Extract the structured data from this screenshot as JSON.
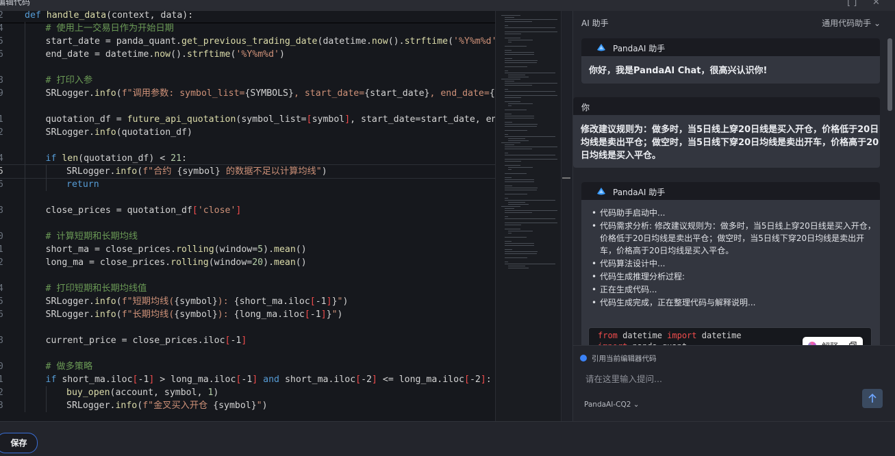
{
  "window": {
    "title": "编辑代码"
  },
  "editor": {
    "lines": [
      {
        "n": "2",
        "indent": 0,
        "tokens": [
          [
            "kw",
            "def "
          ],
          [
            "fn",
            "handle_data"
          ],
          [
            "id",
            "(context, data):"
          ]
        ]
      },
      {
        "n": "4",
        "indent": 1,
        "tokens": [
          [
            "cm",
            "# 使用上一交易日作为开始日期"
          ]
        ]
      },
      {
        "n": "5",
        "indent": 1,
        "tokens": [
          [
            "id",
            "start_date = panda_quant."
          ],
          [
            "fn",
            "get_previous_trading_date"
          ],
          [
            "id",
            "(datetime."
          ],
          [
            "fn",
            "now"
          ],
          [
            "id",
            "()."
          ],
          [
            "fn",
            "strftime"
          ],
          [
            "id",
            "("
          ],
          [
            "str",
            "'%Y%m%d'"
          ],
          [
            "id",
            "))"
          ]
        ]
      },
      {
        "n": "6",
        "indent": 1,
        "tokens": [
          [
            "id",
            "end_date = datetime."
          ],
          [
            "fn",
            "now"
          ],
          [
            "id",
            "()."
          ],
          [
            "fn",
            "strftime"
          ],
          [
            "id",
            "("
          ],
          [
            "str",
            "'%Y%m%d'"
          ],
          [
            "id",
            ")"
          ]
        ]
      },
      {
        "n": "",
        "indent": 1,
        "tokens": []
      },
      {
        "n": "8",
        "indent": 1,
        "tokens": [
          [
            "cm",
            "# 打印入参"
          ]
        ]
      },
      {
        "n": "9",
        "indent": 1,
        "tokens": [
          [
            "id",
            "SRLogger."
          ],
          [
            "fn",
            "info"
          ],
          [
            "id",
            "("
          ],
          [
            "str",
            "f\"调用参数: symbol_list="
          ],
          [
            "id",
            "{SYMBOLS}"
          ],
          [
            "str",
            ", start_date="
          ],
          [
            "id",
            "{start_date}"
          ],
          [
            "str",
            ", end_date="
          ],
          [
            "id",
            "{en"
          ]
        ]
      },
      {
        "n": "",
        "indent": 1,
        "tokens": []
      },
      {
        "n": "1",
        "indent": 1,
        "tokens": [
          [
            "id",
            "quotation_df = "
          ],
          [
            "fn",
            "future_api_quotation"
          ],
          [
            "id",
            "(symbol_list="
          ],
          [
            "red",
            "["
          ],
          [
            "id",
            "symbol"
          ],
          [
            "red",
            "]"
          ],
          [
            "id",
            ", start_date=start_date, end_d"
          ]
        ]
      },
      {
        "n": "2",
        "indent": 1,
        "tokens": [
          [
            "id",
            "SRLogger."
          ],
          [
            "fn",
            "info"
          ],
          [
            "id",
            "(quotation_df)"
          ]
        ]
      },
      {
        "n": "",
        "indent": 1,
        "tokens": []
      },
      {
        "n": "4",
        "indent": 1,
        "tokens": [
          [
            "kw",
            "if "
          ],
          [
            "fn",
            "len"
          ],
          [
            "id",
            "(quotation_df) < "
          ],
          [
            "num",
            "21"
          ],
          [
            "id",
            ":"
          ]
        ]
      },
      {
        "n": "5",
        "indent": 2,
        "active": true,
        "tokens": [
          [
            "id",
            "SRLogger."
          ],
          [
            "fn",
            "info"
          ],
          [
            "id",
            "("
          ],
          [
            "str",
            "f\"合约 "
          ],
          [
            "id",
            "{symbol}"
          ],
          [
            "str",
            " 的数据不足以计算均线\""
          ],
          [
            "id",
            ")"
          ]
        ]
      },
      {
        "n": "6",
        "indent": 2,
        "tokens": [
          [
            "kw",
            "return"
          ]
        ]
      },
      {
        "n": "",
        "indent": 1,
        "tokens": []
      },
      {
        "n": "8",
        "indent": 1,
        "tokens": [
          [
            "id",
            "close_prices = quotation_df"
          ],
          [
            "red",
            "["
          ],
          [
            "str",
            "'close'"
          ],
          [
            "red",
            "]"
          ]
        ]
      },
      {
        "n": "",
        "indent": 1,
        "tokens": []
      },
      {
        "n": "0",
        "indent": 1,
        "tokens": [
          [
            "cm",
            "# 计算短期和长期均线"
          ]
        ]
      },
      {
        "n": "1",
        "indent": 1,
        "tokens": [
          [
            "id",
            "short_ma = close_prices."
          ],
          [
            "fn",
            "rolling"
          ],
          [
            "id",
            "(window="
          ],
          [
            "num",
            "5"
          ],
          [
            "id",
            ")."
          ],
          [
            "fn",
            "mean"
          ],
          [
            "id",
            "()"
          ]
        ]
      },
      {
        "n": "2",
        "indent": 1,
        "tokens": [
          [
            "id",
            "long_ma = close_prices."
          ],
          [
            "fn",
            "rolling"
          ],
          [
            "id",
            "(window="
          ],
          [
            "num",
            "20"
          ],
          [
            "id",
            ")."
          ],
          [
            "fn",
            "mean"
          ],
          [
            "id",
            "()"
          ]
        ]
      },
      {
        "n": "",
        "indent": 1,
        "tokens": []
      },
      {
        "n": "4",
        "indent": 1,
        "tokens": [
          [
            "cm",
            "# 打印短期和长期均线值"
          ]
        ]
      },
      {
        "n": "5",
        "indent": 1,
        "tokens": [
          [
            "id",
            "SRLogger."
          ],
          [
            "fn",
            "info"
          ],
          [
            "id",
            "("
          ],
          [
            "str",
            "f\"短期均线("
          ],
          [
            "id",
            "{symbol}"
          ],
          [
            "str",
            "): "
          ],
          [
            "id",
            "{short_ma.iloc"
          ],
          [
            "red",
            "["
          ],
          [
            "id",
            "-1"
          ],
          [
            "red",
            "]"
          ],
          [
            "id",
            "}"
          ],
          [
            "str",
            "\""
          ],
          [
            "id",
            ")"
          ]
        ]
      },
      {
        "n": "6",
        "indent": 1,
        "tokens": [
          [
            "id",
            "SRLogger."
          ],
          [
            "fn",
            "info"
          ],
          [
            "id",
            "("
          ],
          [
            "str",
            "f\"长期均线("
          ],
          [
            "id",
            "{symbol}"
          ],
          [
            "str",
            "): "
          ],
          [
            "id",
            "{long_ma.iloc"
          ],
          [
            "red",
            "["
          ],
          [
            "id",
            "-1"
          ],
          [
            "red",
            "]"
          ],
          [
            "id",
            "}"
          ],
          [
            "str",
            "\""
          ],
          [
            "id",
            ")"
          ]
        ]
      },
      {
        "n": "",
        "indent": 1,
        "tokens": []
      },
      {
        "n": "8",
        "indent": 1,
        "tokens": [
          [
            "id",
            "current_price = close_prices.iloc"
          ],
          [
            "red",
            "["
          ],
          [
            "id",
            "-1"
          ],
          [
            "red",
            "]"
          ]
        ]
      },
      {
        "n": "",
        "indent": 1,
        "tokens": []
      },
      {
        "n": "0",
        "indent": 1,
        "tokens": [
          [
            "cm",
            "# 做多策略"
          ]
        ]
      },
      {
        "n": "1",
        "indent": 1,
        "tokens": [
          [
            "kw",
            "if "
          ],
          [
            "id",
            "short_ma.iloc"
          ],
          [
            "red",
            "["
          ],
          [
            "id",
            "-1"
          ],
          [
            "red",
            "]"
          ],
          [
            "id",
            " > long_ma.iloc"
          ],
          [
            "red",
            "["
          ],
          [
            "id",
            "-1"
          ],
          [
            "red",
            "]"
          ],
          [
            "kw",
            " and "
          ],
          [
            "id",
            "short_ma.iloc"
          ],
          [
            "red",
            "["
          ],
          [
            "id",
            "-2"
          ],
          [
            "red",
            "]"
          ],
          [
            "id",
            " <= long_ma.iloc"
          ],
          [
            "red",
            "["
          ],
          [
            "id",
            "-2"
          ],
          [
            "red",
            "]"
          ],
          [
            "id",
            ":"
          ]
        ]
      },
      {
        "n": "2",
        "indent": 2,
        "tokens": [
          [
            "fn",
            "buy_open"
          ],
          [
            "id",
            "(account, symbol, "
          ],
          [
            "num",
            "1"
          ],
          [
            "id",
            ")"
          ]
        ]
      },
      {
        "n": "3",
        "indent": 2,
        "tokens": [
          [
            "id",
            "SRLogger."
          ],
          [
            "fn",
            "info"
          ],
          [
            "id",
            "("
          ],
          [
            "str",
            "f\"金叉买入开仓 "
          ],
          [
            "id",
            "{symbol}"
          ],
          [
            "str",
            "\""
          ],
          [
            "id",
            ")"
          ]
        ]
      }
    ]
  },
  "ai": {
    "title": "AI 助手",
    "mode": "通用代码助手",
    "msg1": {
      "name": "PandaAI 助手",
      "text": "你好，我是PandaAI Chat，很高兴认识你!"
    },
    "msg2": {
      "name": "你",
      "text1": "修改建议规则为：做多时，当5日线上穿20日线是买入开仓，价格低于20日",
      "text2": "均线是卖出平仓；做空时，当5日线下穿20日均线是卖出开车，价格高于20",
      "text3": "日均线是买入平仓。"
    },
    "msg3": {
      "name": "PandaAI 助手",
      "items": [
        "代码助手启动中...",
        "代码需求分析:  修改建议规则为：做多时，当5日线上穿20日线是买入开仓，价格低于20日均线是卖出平仓；做空时，当5日线下穿20日均线是卖出开车，价格高于20日均线是买入平仓。",
        "代码算法设计中...",
        "代码生成推理分析过程:",
        "正在生成代码...",
        "代码生成完成，正在整理代码与解释说明..."
      ],
      "code1_kw": "from",
      "code1_a": " datetime ",
      "code1_kw2": "import",
      "code1_b": " datetime",
      "code2_kw": "import",
      "code2_a": " panda_quant",
      "explain_label": "解释"
    },
    "input": {
      "ref_label": "引用当前编辑器代码",
      "placeholder": "请在这里输入提问...",
      "model": "PandaAI-CQ2 ⌄"
    }
  },
  "footer": {
    "save_label": "保存"
  }
}
